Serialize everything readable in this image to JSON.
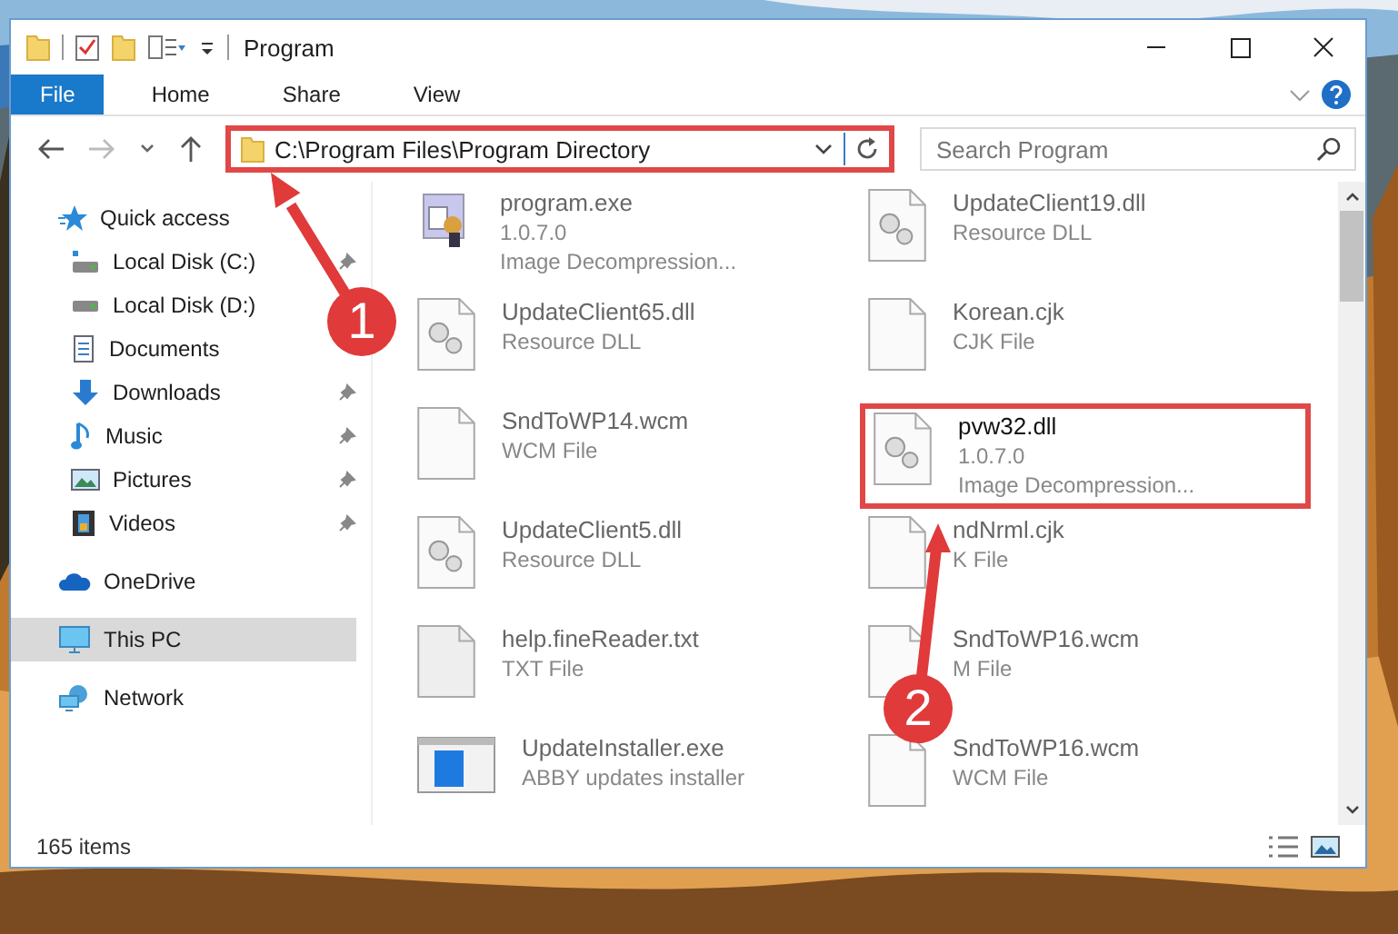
{
  "window": {
    "title": "Program"
  },
  "ribbon_tabs": [
    {
      "label": "File",
      "selected": true
    },
    {
      "label": "Home",
      "selected": false
    },
    {
      "label": "Share",
      "selected": false
    },
    {
      "label": "View",
      "selected": false
    }
  ],
  "address_bar": {
    "path": "C:\\Program Files\\Program Directory",
    "highlighted": true
  },
  "search": {
    "placeholder": "Search Program"
  },
  "sidebar": {
    "items": [
      {
        "label": "Quick access",
        "kind": "star",
        "selected": false,
        "children": [
          {
            "label": "Local Disk (C:)",
            "kind": "drive-c",
            "pinned": true,
            "selected": false
          },
          {
            "label": "Local Disk (D:)",
            "kind": "drive",
            "pinned": false,
            "selected": false
          },
          {
            "label": "Documents",
            "kind": "documents",
            "pinned": false,
            "selected": false
          },
          {
            "label": "Downloads",
            "kind": "downloads",
            "pinned": true,
            "selected": false
          },
          {
            "label": "Music",
            "kind": "music",
            "pinned": true,
            "selected": false
          },
          {
            "label": "Pictures",
            "kind": "pictures",
            "pinned": true,
            "selected": false
          },
          {
            "label": "Videos",
            "kind": "videos",
            "pinned": true,
            "selected": false
          }
        ]
      },
      {
        "label": "OneDrive",
        "kind": "cloud",
        "selected": false
      },
      {
        "label": "This PC",
        "kind": "pc",
        "selected": true
      },
      {
        "label": "Network",
        "kind": "network",
        "selected": false
      }
    ]
  },
  "files": [
    {
      "name": "program.exe",
      "details": [
        "1.0.7.0",
        "Image Decompression..."
      ],
      "kind": "exe",
      "highlighted": false
    },
    {
      "name": "UpdateClient19.dll",
      "details": [
        "Resource DLL"
      ],
      "kind": "dll",
      "highlighted": false
    },
    {
      "name": "UpdateClient65.dll",
      "details": [
        "Resource DLL"
      ],
      "kind": "dll",
      "highlighted": false
    },
    {
      "name": "Korean.cjk",
      "details": [
        "CJK File"
      ],
      "kind": "blank",
      "highlighted": false
    },
    {
      "name": "SndToWP14.wcm",
      "details": [
        "WCM File"
      ],
      "kind": "blank",
      "highlighted": false
    },
    {
      "name": "pvw32.dll",
      "details": [
        "1.0.7.0",
        "Image Decompression..."
      ],
      "kind": "dll",
      "highlighted": true
    },
    {
      "name": "UpdateClient5.dll",
      "details": [
        "Resource DLL"
      ],
      "kind": "dll",
      "highlighted": false
    },
    {
      "name": "ndNrml.cjk",
      "details": [
        "K File"
      ],
      "kind": "blank",
      "highlighted": false
    },
    {
      "name": "help.fineReader.txt",
      "details": [
        "TXT File"
      ],
      "kind": "txt",
      "highlighted": false
    },
    {
      "name": "SndToWP16.wcm",
      "details": [
        "M File"
      ],
      "kind": "blank",
      "highlighted": false
    },
    {
      "name": "UpdateInstaller.exe",
      "details": [
        "ABBY updates installer"
      ],
      "kind": "installer",
      "highlighted": false
    },
    {
      "name": "SndToWP16.wcm",
      "details": [
        "WCM File"
      ],
      "kind": "blank",
      "highlighted": false
    }
  ],
  "status_bar": {
    "item_count": "165 items"
  },
  "annotations": [
    {
      "label": "1"
    },
    {
      "label": "2"
    }
  ]
}
